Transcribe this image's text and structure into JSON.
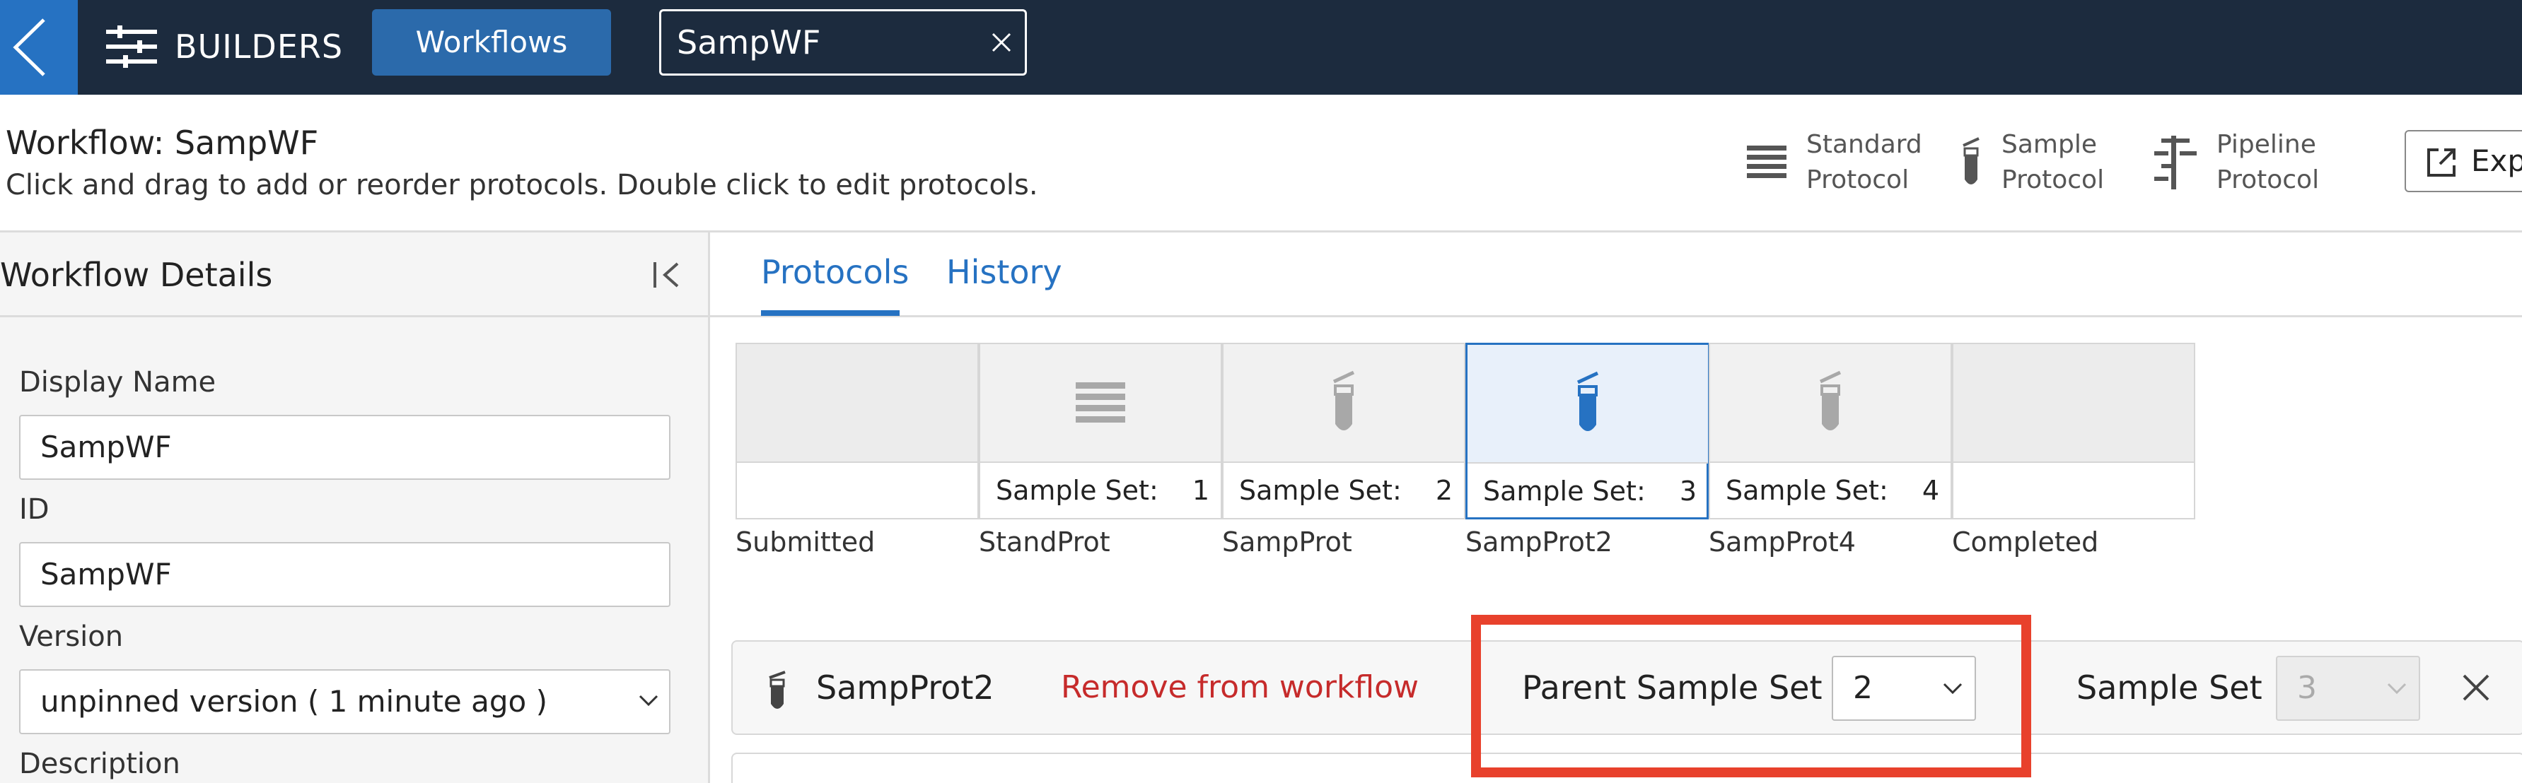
{
  "topbar": {
    "builders_label": "BUILDERS",
    "workflows_button": "Workflows",
    "search_value": "SampWF"
  },
  "header": {
    "title": "Workflow: SampWF",
    "subtitle": "Click and drag to add or reorder protocols. Double click to edit protocols.",
    "legend": {
      "standard": [
        "Standard",
        "Protocol"
      ],
      "sample": [
        "Sample",
        "Protocol"
      ],
      "pipeline": [
        "Pipeline",
        "Protocol"
      ]
    },
    "export_label": "Exp"
  },
  "sidebar": {
    "title": "Workflow Details",
    "display_name_label": "Display Name",
    "display_name_value": "SampWF",
    "id_label": "ID",
    "id_value": "SampWF",
    "version_label": "Version",
    "version_value": "unpinned version ( 1 minute ago )",
    "description_label": "Description"
  },
  "tabs": [
    "Protocols",
    "History"
  ],
  "steps": [
    {
      "name": "Submitted",
      "kind": "empty",
      "count_label": "",
      "count": ""
    },
    {
      "name": "StandProt",
      "kind": "standard",
      "count_label": "Sample Set:",
      "count": "1"
    },
    {
      "name": "SampProt",
      "kind": "sample",
      "count_label": "Sample Set:",
      "count": "2"
    },
    {
      "name": "SampProt2",
      "kind": "sample",
      "selected": true,
      "count_label": "Sample Set:",
      "count": "3"
    },
    {
      "name": "SampProt4",
      "kind": "sample",
      "count_label": "Sample Set:",
      "count": "4"
    },
    {
      "name": "Completed",
      "kind": "empty",
      "count_label": "",
      "count": ""
    }
  ],
  "detail": {
    "protocol_name": "SampProt2",
    "remove_link": "Remove from workflow",
    "parent_sample_set_label": "Parent Sample Set",
    "parent_sample_set_value": "2",
    "sample_set_label": "Sample Set",
    "sample_set_value": "3"
  },
  "colors": {
    "topbar": "#1c2b3e",
    "accent": "#2672c2",
    "remove_link": "#c62b2b",
    "highlight": "#e8412c"
  }
}
